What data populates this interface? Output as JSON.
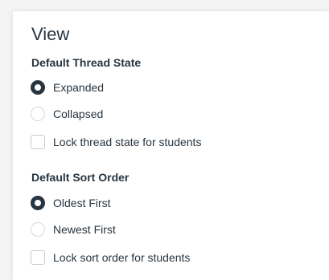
{
  "view": {
    "title": "View",
    "thread_state": {
      "heading": "Default Thread State",
      "options": [
        {
          "label": "Expanded",
          "selected": true
        },
        {
          "label": "Collapsed",
          "selected": false
        }
      ],
      "lock_label": "Lock thread state for students",
      "lock_checked": false
    },
    "sort_order": {
      "heading": "Default Sort Order",
      "options": [
        {
          "label": "Oldest First",
          "selected": true
        },
        {
          "label": "Newest First",
          "selected": false
        }
      ],
      "lock_label": "Lock sort order for students",
      "lock_checked": false
    }
  },
  "colors": {
    "text": "#273540",
    "border": "#d4d8dc",
    "panel": "#ffffff",
    "background": "#f4f4f4"
  }
}
